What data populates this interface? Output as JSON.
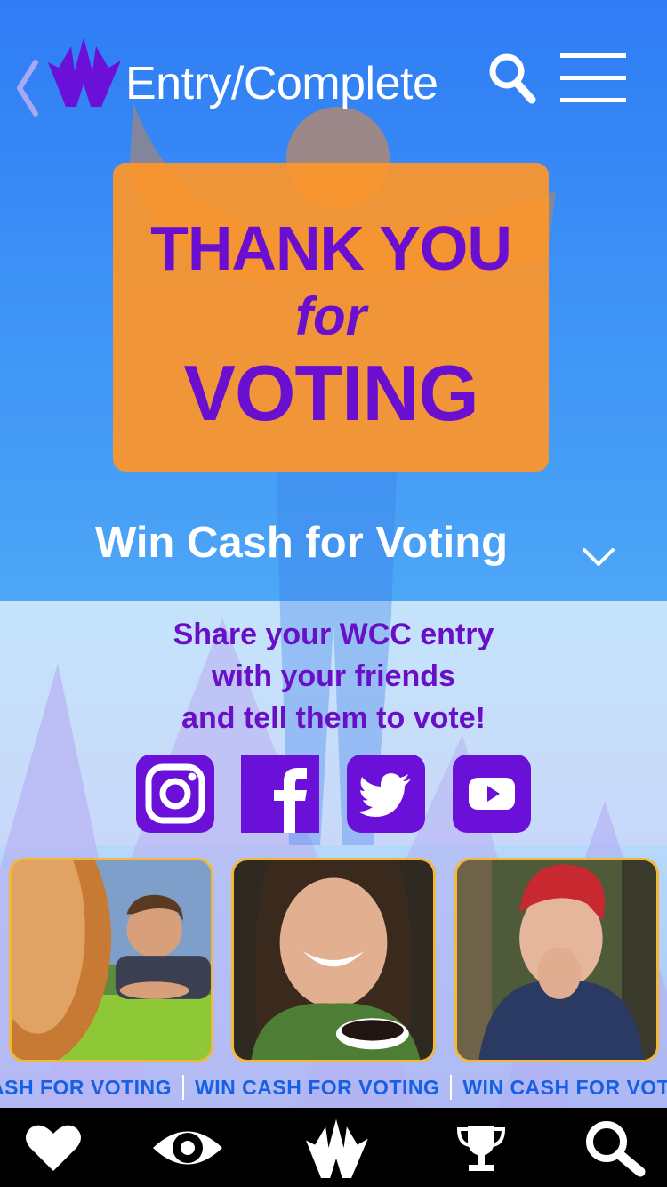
{
  "header": {
    "title": "Entry/Complete"
  },
  "thank_you": {
    "line1": "THANK YOU",
    "line2": "for",
    "line3": "VOTING"
  },
  "promo": {
    "heading": "Win Cash for Voting"
  },
  "share": {
    "line1": "Share your WCC entry",
    "line2": "with your friends",
    "line3": "and tell them to vote!"
  },
  "social_buttons": [
    "instagram-icon",
    "facebook-icon",
    "twitter-icon",
    "youtube-icon"
  ],
  "ticker": {
    "items": [
      "ASH FOR VOTING",
      "WIN CASH FOR VOTING",
      "WIN CASH FOR VOTING"
    ]
  },
  "photos": [
    "donut-and-boy-photo",
    "woman-coffee-photo",
    "girl-red-hat-photo"
  ],
  "bottom_nav": [
    "heart-icon",
    "eye-icon",
    "logo-icon",
    "trophy-icon",
    "search-icon"
  ],
  "colors": {
    "brand_purple": "#6a0fd0",
    "card_orange": "#ff9628",
    "hero_blue": "#2f7cf5",
    "ticker_blue": "#1660e6"
  }
}
